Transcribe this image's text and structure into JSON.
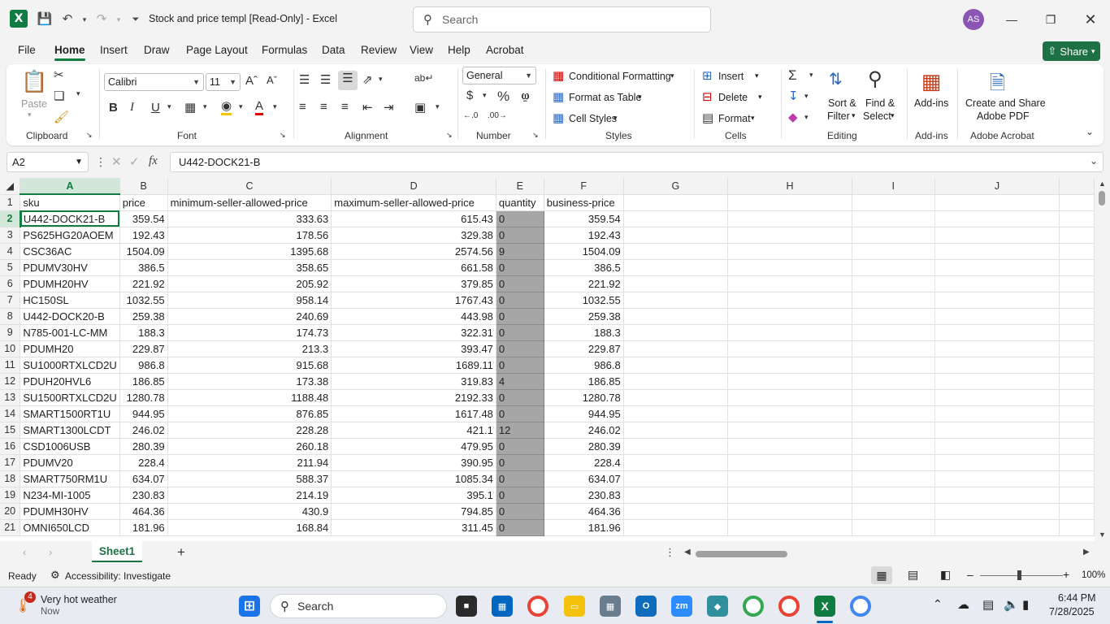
{
  "window": {
    "title": "Stock and price templ  [Read-Only]  -  Excel",
    "search_placeholder": "Search",
    "user_initials": "AS"
  },
  "menu": {
    "tabs": [
      "File",
      "Home",
      "Insert",
      "Draw",
      "Page Layout",
      "Formulas",
      "Data",
      "Review",
      "View",
      "Help",
      "Acrobat"
    ],
    "active_tab": "Home",
    "share_label": "Share"
  },
  "ribbon": {
    "clipboard": {
      "paste": "Paste",
      "label": "Clipboard"
    },
    "font": {
      "name": "Calibri",
      "size": "11",
      "label": "Font"
    },
    "alignment": {
      "label": "Alignment"
    },
    "number": {
      "format": "General",
      "label": "Number"
    },
    "styles": {
      "conditional": "Conditional Formatting",
      "format_table": "Format as Table",
      "cell_styles": "Cell Styles",
      "label": "Styles"
    },
    "cells": {
      "insert": "Insert",
      "delete": "Delete",
      "format": "Format",
      "label": "Cells"
    },
    "editing": {
      "sort_1": "Sort &",
      "sort_2": "Filter",
      "find_1": "Find &",
      "find_2": "Select",
      "label": "Editing"
    },
    "addins": {
      "button": "Add-ins",
      "label": "Add-ins"
    },
    "acrobat": {
      "line1": "Create and Share",
      "line2": "Adobe PDF",
      "label": "Adobe Acrobat"
    }
  },
  "formula_bar": {
    "name_box": "A2",
    "fx": "fx",
    "content": "U442-DOCK21-B"
  },
  "sheet": {
    "columns": [
      "A",
      "B",
      "C",
      "D",
      "E",
      "F",
      "G",
      "H",
      "I",
      "J"
    ],
    "header_row": [
      "sku",
      "price",
      "minimum-seller-allowed-price",
      "maximum-seller-allowed-price",
      "quantity",
      "business-price"
    ],
    "rows": [
      [
        "U442-DOCK21-B",
        "359.54",
        "333.63",
        "615.43",
        "0",
        "359.54"
      ],
      [
        "PS625HG20AOEM",
        "192.43",
        "178.56",
        "329.38",
        "0",
        "192.43"
      ],
      [
        "CSC36AC",
        "1504.09",
        "1395.68",
        "2574.56",
        "9",
        "1504.09"
      ],
      [
        "PDUMV30HV",
        "386.5",
        "358.65",
        "661.58",
        "0",
        "386.5"
      ],
      [
        "PDUMH20HV",
        "221.92",
        "205.92",
        "379.85",
        "0",
        "221.92"
      ],
      [
        "HC150SL",
        "1032.55",
        "958.14",
        "1767.43",
        "0",
        "1032.55"
      ],
      [
        "U442-DOCK20-B",
        "259.38",
        "240.69",
        "443.98",
        "0",
        "259.38"
      ],
      [
        "N785-001-LC-MM",
        "188.3",
        "174.73",
        "322.31",
        "0",
        "188.3"
      ],
      [
        "PDUMH20",
        "229.87",
        "213.3",
        "393.47",
        "0",
        "229.87"
      ],
      [
        "SU1000RTXLCD2U",
        "986.8",
        "915.68",
        "1689.11",
        "0",
        "986.8"
      ],
      [
        "PDUH20HVL6",
        "186.85",
        "173.38",
        "319.83",
        "4",
        "186.85"
      ],
      [
        "SU1500RTXLCD2U",
        "1280.78",
        "1188.48",
        "2192.33",
        "0",
        "1280.78"
      ],
      [
        "SMART1500RT1U",
        "944.95",
        "876.85",
        "1617.48",
        "0",
        "944.95"
      ],
      [
        "SMART1300LCDT",
        "246.02",
        "228.28",
        "421.1",
        "12",
        "246.02"
      ],
      [
        "CSD1006USB",
        "280.39",
        "260.18",
        "479.95",
        "0",
        "280.39"
      ],
      [
        "PDUMV20",
        "228.4",
        "211.94",
        "390.95",
        "0",
        "228.4"
      ],
      [
        "SMART750RM1U",
        "634.07",
        "588.37",
        "1085.34",
        "0",
        "634.07"
      ],
      [
        "N234-MI-1005",
        "230.83",
        "214.19",
        "395.1",
        "0",
        "230.83"
      ],
      [
        "PDUMH30HV",
        "464.36",
        "430.9",
        "794.85",
        "0",
        "464.36"
      ],
      [
        "OMNI650LCD",
        "181.96",
        "168.84",
        "311.45",
        "0",
        "181.96"
      ]
    ],
    "sheet_tab": "Sheet1"
  },
  "status": {
    "ready": "Ready",
    "accessibility": "Accessibility: Investigate",
    "zoom": "100%"
  },
  "taskbar": {
    "weather_title": "Very hot weather",
    "weather_sub": "Now",
    "weather_badge": "4",
    "search": "Search",
    "time": "6:44 PM",
    "date": "7/28/2025"
  },
  "colors": {
    "excel_green": "#107c41",
    "quantity_fill": "#a6a6a6",
    "avatar": "#8a55b5"
  }
}
